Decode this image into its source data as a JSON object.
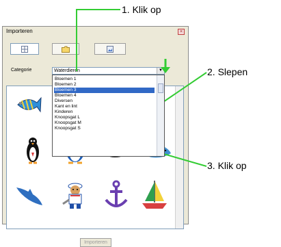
{
  "annotations": {
    "step1": "1. Klik op",
    "step2": "2. Slepen",
    "step3": "3. Klik op"
  },
  "window": {
    "title": "Importeren",
    "close_glyph": "×",
    "toolbar_icons": [
      "grid-view-icon",
      "folder-icon",
      "image-icon"
    ]
  },
  "category": {
    "label": "Categorie",
    "selected_value": "Waterdieren",
    "options": [
      "Bloemen 1",
      "Bloemen 2",
      "Bloemen 3",
      "Bloemen 4",
      "Diversen",
      "Kant en lint",
      "Kinderen",
      "Knoopsgat L",
      "Knoopsgat M",
      "Knoopsgat S"
    ],
    "highlighted_option": "Bloemen 3"
  },
  "thumbnails": [
    "fish",
    "penguin",
    "penguin-blue",
    "whale",
    "dolphin",
    "dolphin-2",
    "sailor-bear",
    "anchor",
    "sailboat"
  ],
  "buttons": {
    "import_label": "Importeren"
  },
  "colors": {
    "callout_line": "#33cc33",
    "selection": "#3169c6"
  }
}
